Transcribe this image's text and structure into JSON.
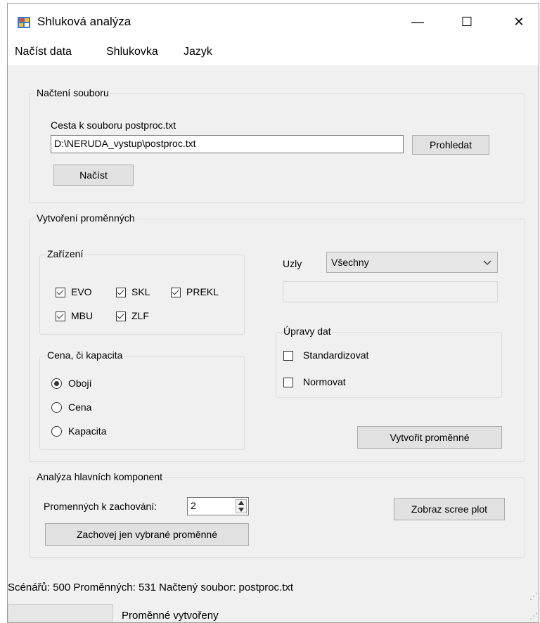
{
  "window": {
    "title": "Shluková analýza"
  },
  "controls": {
    "minimize": "—",
    "maximize": "☐",
    "close": "✕"
  },
  "menu": [
    "Načíst data",
    "Shlukovka",
    "Jazyk"
  ],
  "load_group": {
    "legend": "Načtení souboru",
    "path_label": "Cesta k souboru postproc.txt",
    "path_value": "D:\\NERUDA_vystup\\postproc.txt",
    "browse_button": "Prohledat",
    "load_button": "Načíst"
  },
  "vars_group": {
    "legend": "Vytvoření proměnných",
    "devices": {
      "legend": "Zařízení",
      "items": [
        {
          "label": "EVO",
          "checked": true
        },
        {
          "label": "SKL",
          "checked": true
        },
        {
          "label": "PREKL",
          "checked": true
        },
        {
          "label": "MBU",
          "checked": true
        },
        {
          "label": "ZLF",
          "checked": true
        }
      ]
    },
    "price": {
      "legend": "Cena, či kapacita",
      "options": [
        {
          "label": "Obojí",
          "selected": true
        },
        {
          "label": "Cena",
          "selected": false
        },
        {
          "label": "Kapacita",
          "selected": false
        }
      ]
    },
    "nodes_label": "Uzly",
    "nodes_value": "Všechny",
    "data_edit": {
      "legend": "Úpravy dat",
      "items": [
        {
          "label": "Standardizovat",
          "checked": false
        },
        {
          "label": "Normovat",
          "checked": false
        }
      ]
    },
    "create_button": "Vytvořit proměnné"
  },
  "pca_group": {
    "legend": "Analýza hlavních komponent",
    "keep_label": "Promenných k zachování:",
    "keep_value": "2",
    "keep_selected_button": "Zachovej jen vybrané proměnné",
    "scree_button": "Zobraz scree plot"
  },
  "status": {
    "summary": "Scénářů: 500  Proměnných: 531  Načtený soubor: postproc.txt",
    "message": "Proměnné vytvořeny"
  }
}
